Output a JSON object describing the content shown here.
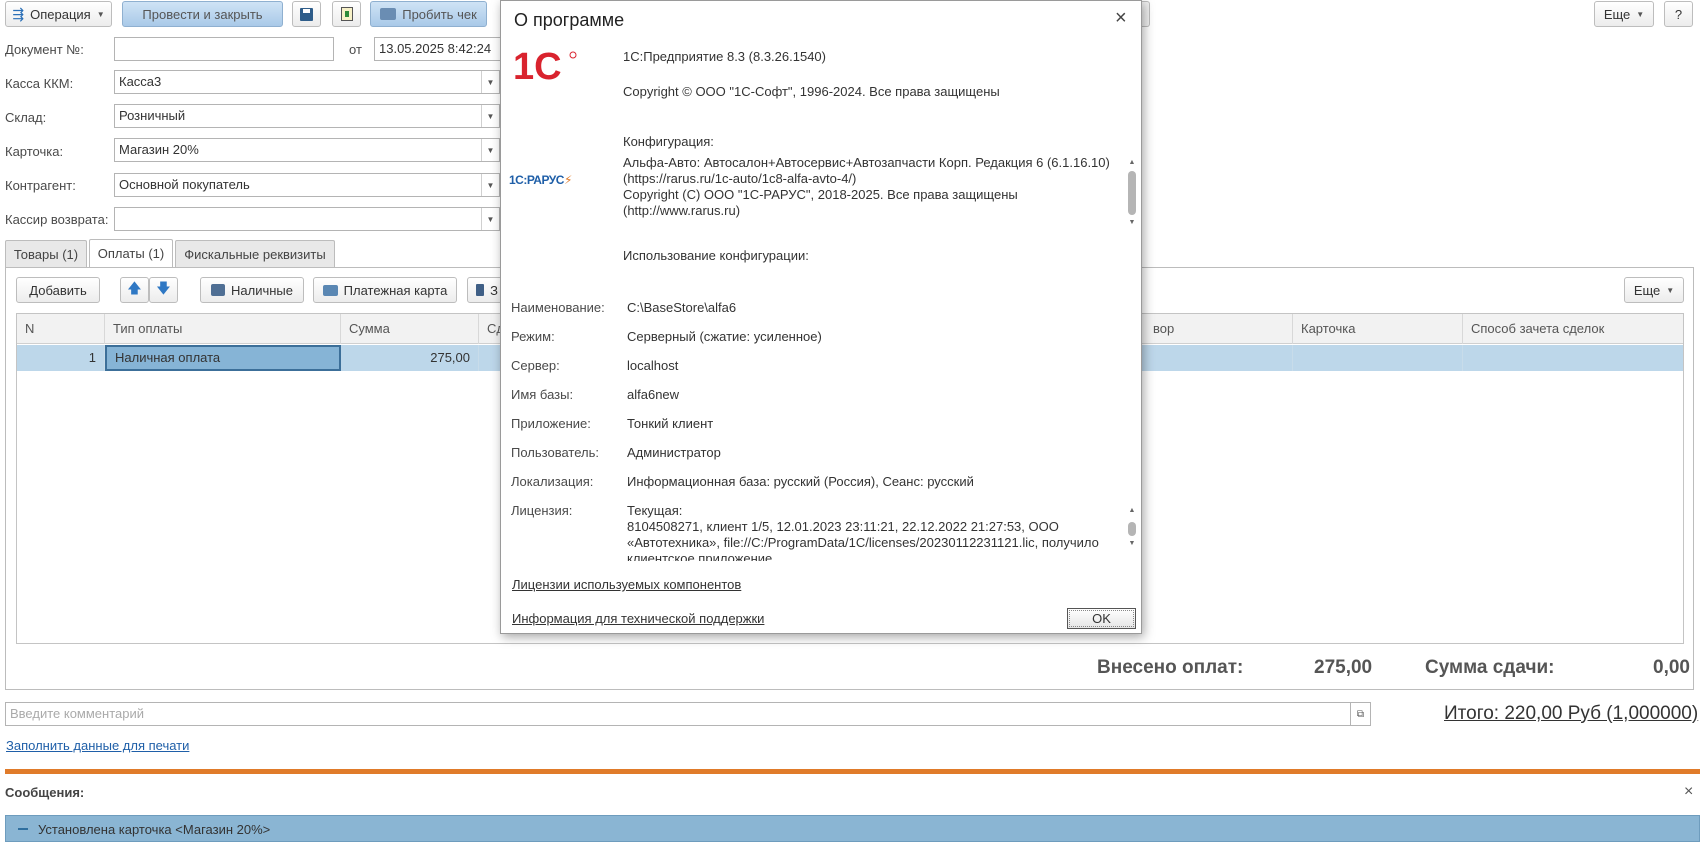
{
  "toolbar": {
    "operation": "Операция",
    "post_close": "Провести и закрыть",
    "print_check": "Пробить чек",
    "more": "Еще",
    "help": "?"
  },
  "form": {
    "doc_label": "Документ №:",
    "doc_value": "",
    "from_label": "от",
    "date_value": "13.05.2025  8:42:24",
    "kkm_label": "Касса ККМ:",
    "kkm_value": "Касса3",
    "warehouse_label": "Склад:",
    "warehouse_value": "Розничный",
    "card_label": "Карточка:",
    "card_value": "Магазин 20%",
    "counterparty_label": "Контрагент:",
    "counterparty_value": "Основной покупатель",
    "cashier_label": "Кассир возврата:",
    "cashier_value": ""
  },
  "tabs": [
    "Товары (1)",
    "Оплаты (1)",
    "Фискальные реквизиты"
  ],
  "payments_toolbar": {
    "add": "Добавить",
    "cash": "Наличные",
    "card": "Платежная карта",
    "cut_label": "З",
    "more": "Еще"
  },
  "table": {
    "headers": [
      "N",
      "Тип оплаты",
      "Сумма",
      "Сд",
      "вор",
      "Карточка",
      "Способ зачета сделок"
    ],
    "row": {
      "n": "1",
      "type": "Наличная оплата",
      "sum": "275,00"
    }
  },
  "totals": {
    "paid_label": "Внесено оплат:",
    "paid_value": "275,00",
    "change_label": "Сумма сдачи:",
    "change_value": "0,00",
    "total": "Итого: 220,00 Руб (1,000000)"
  },
  "comment_placeholder": "Введите комментарий",
  "fill_print_link": "Заполнить данные для печати",
  "messages": {
    "title": "Сообщения:",
    "close": "×",
    "item": "Установлена карточка <Магазин 20%>"
  },
  "dialog": {
    "title": "О программе",
    "close": "×",
    "logo_1c": "1С",
    "logo_rarus": "1С:РАРУС",
    "platform": "1С:Предприятие 8.3 (8.3.26.1540)",
    "copyright": "Copyright © ООО \"1С-Софт\", 1996-2024. Все права защищены",
    "config_label": "Конфигурация:",
    "config_line1": "Альфа-Авто: Автосалон+Автосервис+Автозапчасти Корп. Редакция 6 (6.1.16.10)",
    "config_line2": "(https://rarus.ru/1c-auto/1c8-alfa-avto-4/)",
    "config_line3": "Copyright (C) ООО \"1С-РАРУС\", 2018-2025. Все права защищены",
    "config_line4": "(http://www.rarus.ru)",
    "usage_label": "Использование конфигурации:",
    "info": {
      "name_label": "Наименование:",
      "name_value": "C:\\BaseStore\\alfa6",
      "mode_label": "Режим:",
      "mode_value": "Серверный (сжатие: усиленное)",
      "server_label": "Сервер:",
      "server_value": "localhost",
      "db_label": "Имя базы:",
      "db_value": "alfa6new",
      "app_label": "Приложение:",
      "app_value": "Тонкий клиент",
      "user_label": "Пользователь:",
      "user_value": "Администратор",
      "locale_label": "Локализация:",
      "locale_value": "Информационная база: русский (Россия), Сеанс: русский",
      "license_label": "Лицензия:",
      "license_line1": "Текущая:",
      "license_line2": "8104508271, клиент 1/5, 12.01.2023 23:11:21, 22.12.2022 21:27:53, ООО",
      "license_line3": "«Автотехника», file://C:/ProgramData/1C/licenses/20230112231121.lic, получило",
      "license_line4": "клиентское приложение"
    },
    "components_link": "Лицензии используемых компонентов",
    "support_link": "Информация для технической поддержки",
    "ok": "OK"
  },
  "colors": {
    "accent_orange": "#e07b2a",
    "selection_blue": "#bdd7ea",
    "message_bg": "#8ab5d3",
    "logo_red": "#d9232e"
  }
}
